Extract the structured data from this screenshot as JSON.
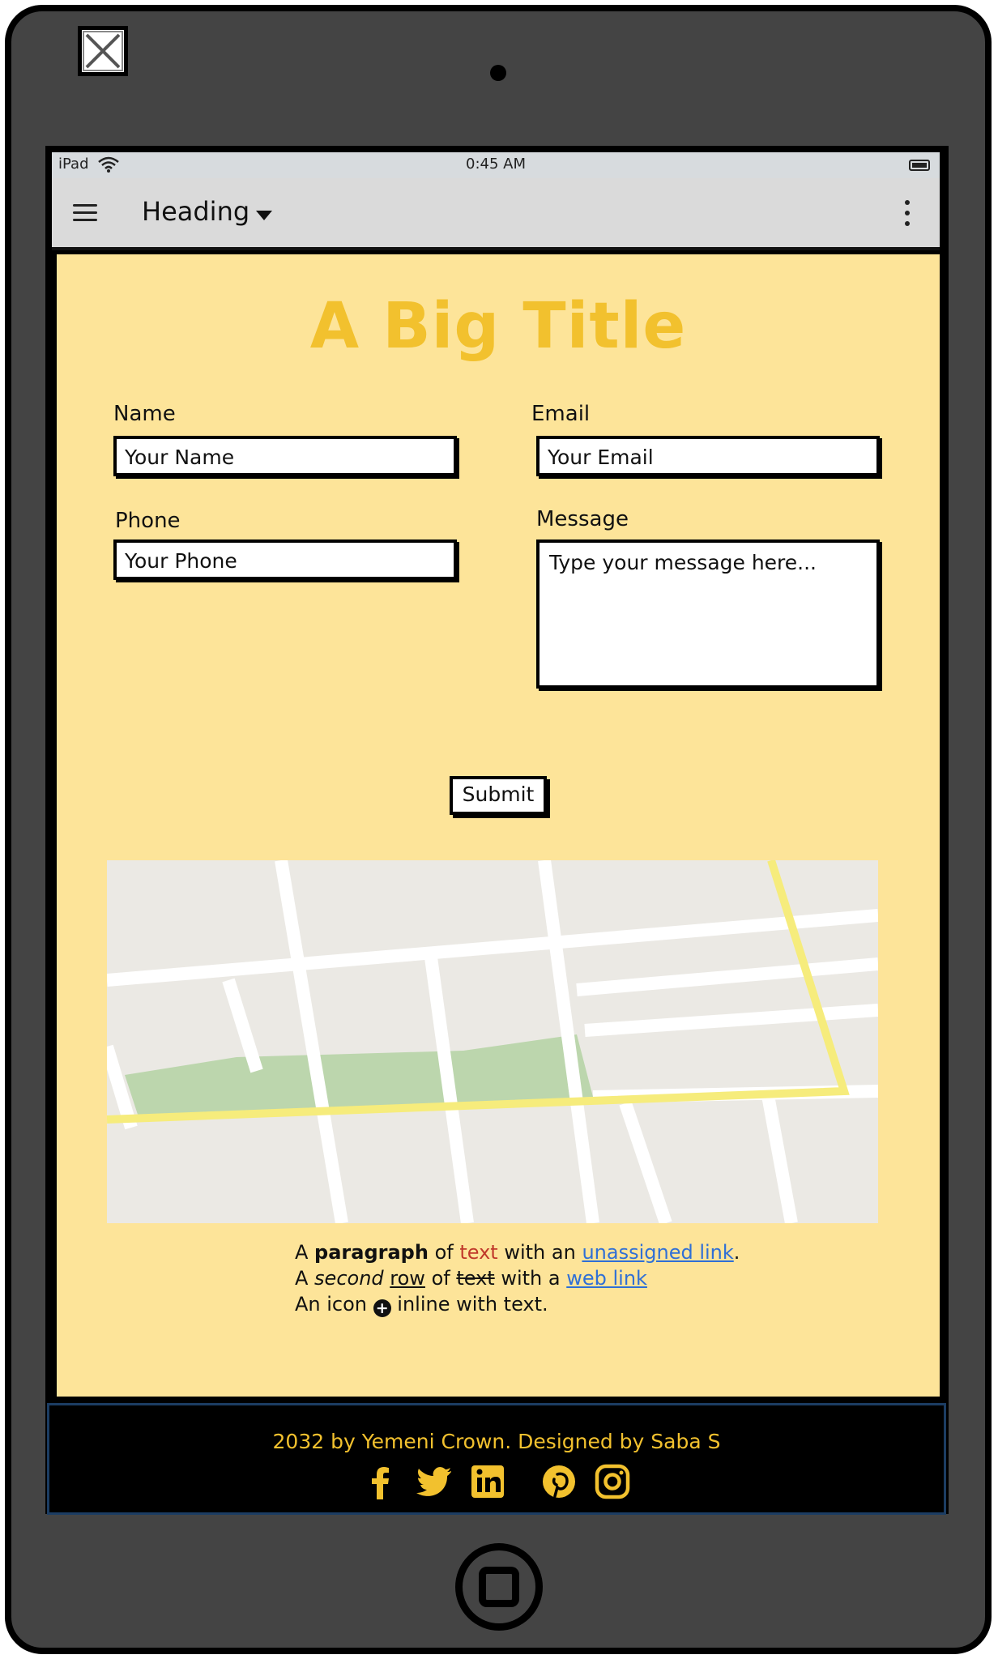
{
  "status_bar": {
    "device": "iPad",
    "time": "0:45 AM"
  },
  "app_bar": {
    "heading": "Heading"
  },
  "page": {
    "title": "A Big Title"
  },
  "form": {
    "name_label": "Name",
    "name_placeholder": "Your Name",
    "email_label": "Email",
    "email_placeholder": "Your Email",
    "phone_label": "Phone",
    "phone_placeholder": "Your Phone",
    "message_label": "Message",
    "message_placeholder": "Type your message here...",
    "submit_label": "Submit"
  },
  "paragraph": {
    "l1_a": "A ",
    "l1_bold": "paragraph",
    "l1_b": " of ",
    "l1_red": "text",
    "l1_c": " with an ",
    "l1_link": "unassigned link",
    "l1_d": ".",
    "l2_a": "A ",
    "l2_italic": "second",
    "l2_b": " ",
    "l2_underline": "row",
    "l2_c": " of ",
    "l2_strike": "text",
    "l2_d": " with a ",
    "l2_link": "web link",
    "l3_a": "An icon ",
    "l3_b": " inline with text."
  },
  "footer": {
    "credit": "2032 by Yemeni Crown. Designed by Saba S",
    "social": [
      "facebook-icon",
      "twitter-icon",
      "linkedin-icon",
      "pinterest-icon",
      "instagram-icon"
    ]
  },
  "colors": {
    "accent": "#f2c12e",
    "content_bg": "#fde499",
    "link": "#2f6fd6",
    "red_text": "#c0392b",
    "map_park": "#bcd6ad",
    "map_highlight_road": "#f6ec7c"
  }
}
